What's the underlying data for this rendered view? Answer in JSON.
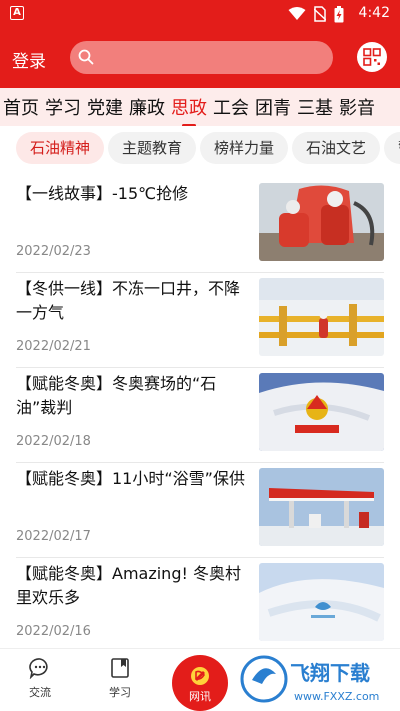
{
  "status_bar": {
    "time": "4:42",
    "app_badge": "A"
  },
  "header": {
    "login_label": "登录",
    "search_placeholder": ""
  },
  "nav": {
    "items": [
      "首页",
      "学习",
      "党建",
      "廉政",
      "思政",
      "工会",
      "团青",
      "三基",
      "影音"
    ],
    "active_index": 4
  },
  "chips": {
    "items": [
      "石油精神",
      "主题教育",
      "榜样力量",
      "石油文艺",
      "警"
    ],
    "active_index": 0
  },
  "news": [
    {
      "title": "【一线故事】-15℃抢修",
      "date": "2022/02/23",
      "thumb": "workers-in-red"
    },
    {
      "title": "【冬供一线】不冻一口井，不降一方气",
      "date": "2022/02/21",
      "thumb": "snowy-pipeline"
    },
    {
      "title": "【赋能冬奥】冬奥赛场的“石油”裁判",
      "date": "2022/02/18",
      "thumb": "petrochina-flag"
    },
    {
      "title": "【赋能冬奥】11小时“浴雪”保供",
      "date": "2022/02/17",
      "thumb": "gas-station"
    },
    {
      "title": "【赋能冬奥】Amazing! 冬奥村里欢乐多",
      "date": "2022/02/16",
      "thumb": "olympic-flag"
    }
  ],
  "tabbar": {
    "items": [
      {
        "label": "交流",
        "icon": "chat-bubble-icon"
      },
      {
        "label": "学习",
        "icon": "book-icon"
      },
      {
        "label": "网讯",
        "icon": "party-emblem-icon"
      }
    ]
  },
  "watermark": {
    "brand": "飞翔下载",
    "url": "www.FXXZ.com"
  },
  "colors": {
    "accent": "#e31d1a",
    "nav_bg": "#fdeceb",
    "chip_active_bg": "#fde8e7"
  }
}
